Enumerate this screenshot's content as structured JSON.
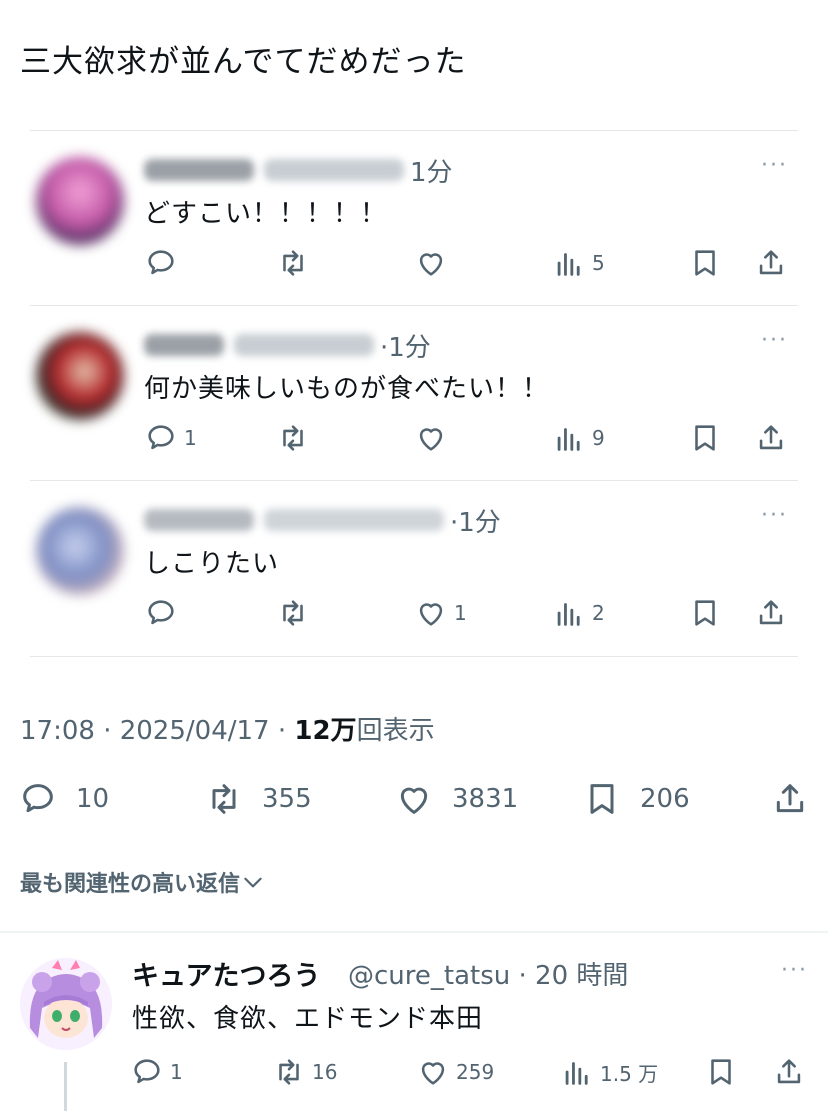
{
  "tweet": {
    "text": "三大欲求が並んでてだめだった",
    "timestamp": "17:08 · 2025/04/17 · ",
    "views_value": "12万",
    "views_label": "回表示",
    "stats": {
      "replies": "10",
      "retweets": "355",
      "likes": "3831",
      "bookmarks": "206"
    }
  },
  "quoted_replies": [
    {
      "time": "1分",
      "text": "どすこい！！！！！",
      "replies": "",
      "likes": "",
      "views": "5"
    },
    {
      "time": "·1分",
      "text": "何か美味しいものが食べたい！！",
      "replies": "1",
      "likes": "",
      "views": "9"
    },
    {
      "time": "·1分",
      "text": "しこりたい",
      "replies": "",
      "likes": "1",
      "views": "2"
    }
  ],
  "sort_label": "最も関連性の高い返信",
  "reply": {
    "name": "キュアたつろう",
    "handle": "@cure_tatsu · 20 時間",
    "text": "性欲、食欲、エドモンド本田",
    "replies": "1",
    "retweets": "16",
    "likes": "259",
    "views": "1.5 万"
  },
  "more_label": "···"
}
